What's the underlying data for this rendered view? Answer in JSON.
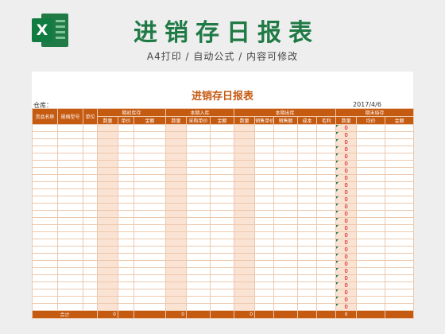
{
  "header": {
    "title": "进销存日报表",
    "subtitle": "A4打印 / 自动公式 / 内容可修改",
    "logo_letter": "X",
    "logo_icon": "excel-icon"
  },
  "sheet": {
    "title": "进销存日报表",
    "warehouse_label": "仓库：",
    "date": "2017/4/6",
    "groups": [
      "期初库存",
      "本期入库",
      "本期出库",
      "期末结存"
    ],
    "fixed_columns": [
      "货品名称",
      "规格型号",
      "单位"
    ],
    "subheaders": {
      "opening": [
        "数量",
        "单价",
        "金额"
      ],
      "inbound": [
        "数量",
        "采购单价",
        "金额"
      ],
      "outbound": [
        "数量",
        "销售单价",
        "销售额",
        "成本",
        "毛利"
      ],
      "closing": [
        "数量",
        "均价",
        "金额"
      ]
    },
    "closing_qty_values": [
      "0",
      "0",
      "0",
      "0",
      "0",
      "0",
      "0",
      "0",
      "0",
      "0",
      "0",
      "0",
      "0",
      "0",
      "0",
      "0",
      "0",
      "0",
      "0",
      "0",
      "0",
      "0",
      "0",
      "0",
      "0",
      "0"
    ],
    "footer": {
      "label": "合计",
      "opening_qty": "0",
      "inbound_qty": "0",
      "outbound_qty": "0",
      "closing_qty": "0"
    }
  },
  "colors": {
    "accent_green": "#1f7a45",
    "header_orange": "#c55a11",
    "shade": "#fbe3d4",
    "zero_red": "#cc0000"
  }
}
